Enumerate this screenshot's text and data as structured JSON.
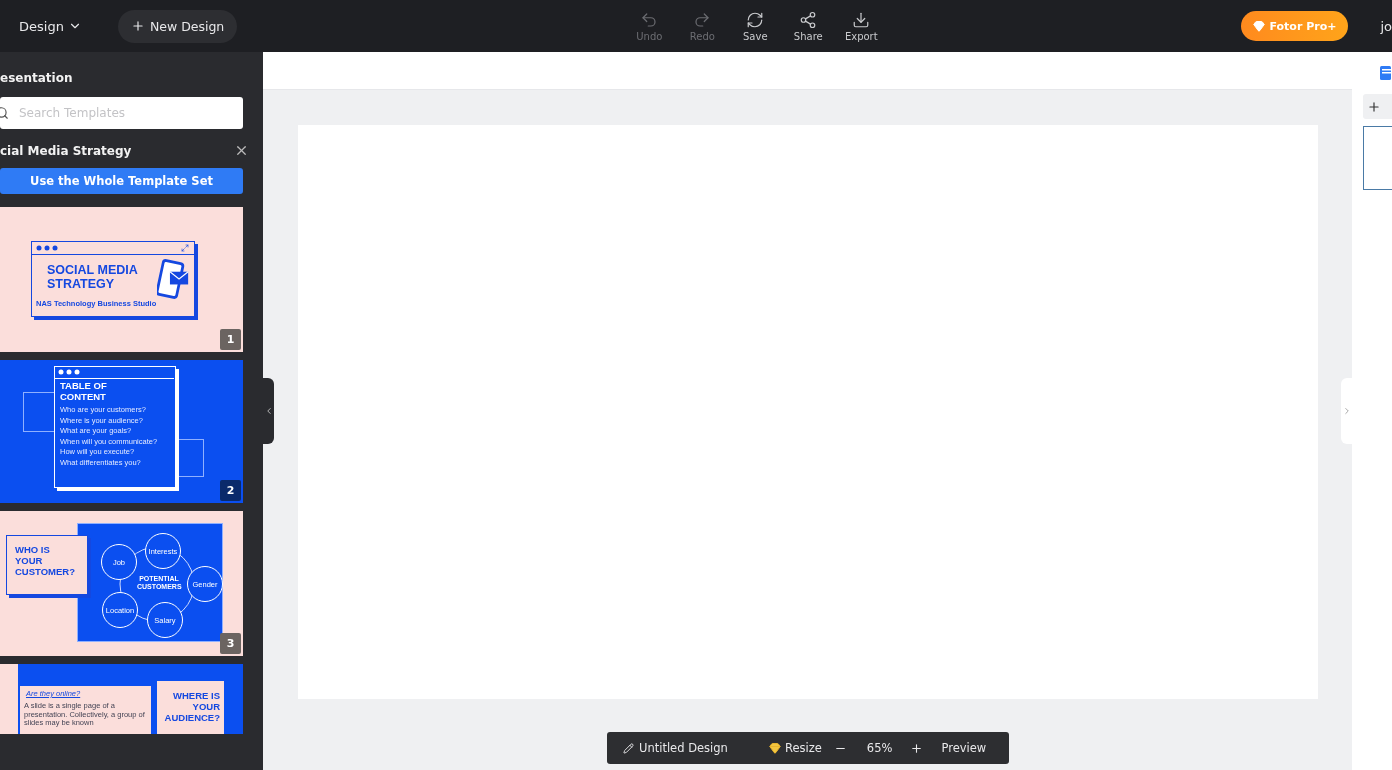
{
  "top_bar": {
    "menu": "Design",
    "new_design": "New Design",
    "actions": [
      {
        "kind": "undo",
        "label": "Undo",
        "disabled": true
      },
      {
        "kind": "redo",
        "label": "Redo",
        "disabled": true
      },
      {
        "kind": "save",
        "label": "Save",
        "disabled": false
      },
      {
        "kind": "share",
        "label": "Share",
        "disabled": false
      },
      {
        "kind": "export",
        "label": "Export",
        "disabled": false
      }
    ],
    "pro_button": "Fotor Pro+",
    "user": "jo"
  },
  "left_panel": {
    "heading": "esentation",
    "search": {
      "placeholder": "Search Templates"
    },
    "set_title": "cial Media Strategy",
    "use_button": "Use the Whole Template Set",
    "slides": [
      {
        "kind": "cover",
        "number": "1",
        "title_lines": [
          "SOCIAL MEDIA",
          "STRATEGY"
        ],
        "subtitle": "NAS Technology Business Studio"
      },
      {
        "kind": "contents",
        "number": "2",
        "title_lines": [
          "TABLE OF",
          "CONTENT"
        ],
        "items": [
          "Who are your customers?",
          "Where is your audience?",
          "What are your goals?",
          "When will you communicate?",
          "How will you execute?",
          "What differentiates you?"
        ]
      },
      {
        "kind": "diagram",
        "number": "3",
        "title_lines": [
          "WHO IS",
          "YOUR",
          "CUSTOMER?"
        ],
        "center_lines": [
          "POTENTIAL",
          "CUSTOMERS"
        ],
        "nodes": [
          "Interests",
          "Job",
          "Gender",
          "Location",
          "Salary"
        ]
      },
      {
        "kind": "text",
        "heading": "Are they online?",
        "body": "A slide is a single page of a presentation. Collectively, a group of slides may be known",
        "title_lines": [
          "WHERE IS",
          "YOUR",
          "AUDIENCE?"
        ]
      }
    ]
  },
  "bottom_bar": {
    "title": "Untitled Design",
    "resize": "Resize",
    "zoom": "65%",
    "preview": "Preview"
  }
}
